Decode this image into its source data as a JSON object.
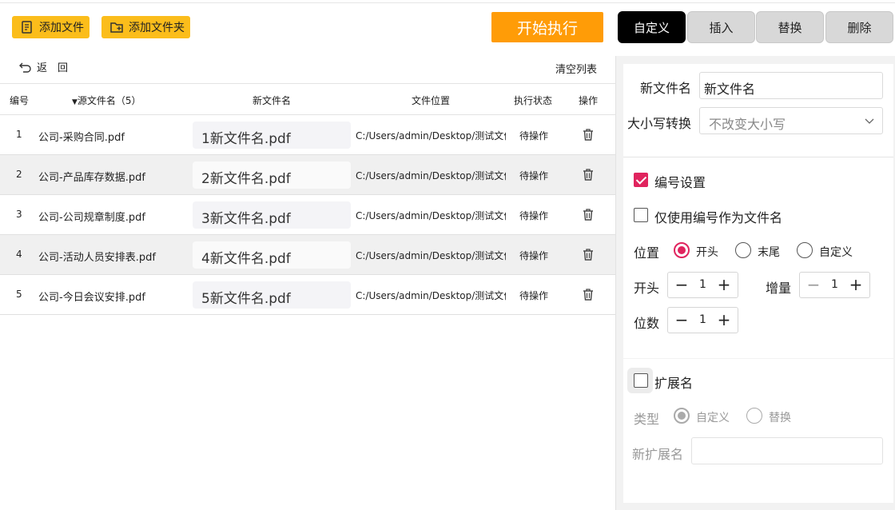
{
  "toolbar": {
    "add_file": "添加文件",
    "add_folder": "添加文件夹",
    "start": "开始执行",
    "back": "返　回",
    "clear": "清空列表"
  },
  "tabs": [
    "自定义",
    "插入",
    "替换",
    "删除"
  ],
  "table": {
    "headers": [
      "编号",
      "源文件名（5）",
      "新文件名",
      "文件位置",
      "执行状态",
      "操作"
    ],
    "rows": [
      {
        "no": "1",
        "src": "公司-采购合同.pdf",
        "new": "1新文件名.pdf",
        "loc": "C:/Users/admin/Desktop/测试文件",
        "status": "待操作"
      },
      {
        "no": "2",
        "src": "公司-产品库存数据.pdf",
        "new": "2新文件名.pdf",
        "loc": "C:/Users/admin/Desktop/测试文件",
        "status": "待操作"
      },
      {
        "no": "3",
        "src": "公司-公司规章制度.pdf",
        "new": "3新文件名.pdf",
        "loc": "C:/Users/admin/Desktop/测试文件",
        "status": "待操作"
      },
      {
        "no": "4",
        "src": "公司-活动人员安排表.pdf",
        "new": "4新文件名.pdf",
        "loc": "C:/Users/admin/Desktop/测试文件",
        "status": "待操作"
      },
      {
        "no": "5",
        "src": "公司-今日会议安排.pdf",
        "new": "5新文件名.pdf",
        "loc": "C:/Users/admin/Desktop/测试文件",
        "status": "待操作"
      }
    ]
  },
  "panel": {
    "new_name_label": "新文件名",
    "new_name_value": "新文件名",
    "case_label": "大小写转换",
    "case_value": "不改变大小写",
    "numbering_label": "编号设置",
    "numbering_checked": true,
    "only_number_label": "仅使用编号作为文件名",
    "only_number_checked": false,
    "position_label": "位置",
    "position_options": [
      "开头",
      "末尾",
      "自定义"
    ],
    "position_selected": "开头",
    "start_label": "开头",
    "start_value": "1",
    "increment_label": "增量",
    "increment_value": "1",
    "digits_label": "位数",
    "digits_value": "1",
    "ext_label": "扩展名",
    "ext_checked": false,
    "type_label": "类型",
    "type_options": [
      "自定义",
      "替换"
    ],
    "type_selected": "自定义",
    "new_ext_label": "新扩展名",
    "new_ext_value": ""
  },
  "colors": {
    "accent": "#e0245e",
    "yellow": "#fbbd1b",
    "orange": "#ff9c07"
  }
}
